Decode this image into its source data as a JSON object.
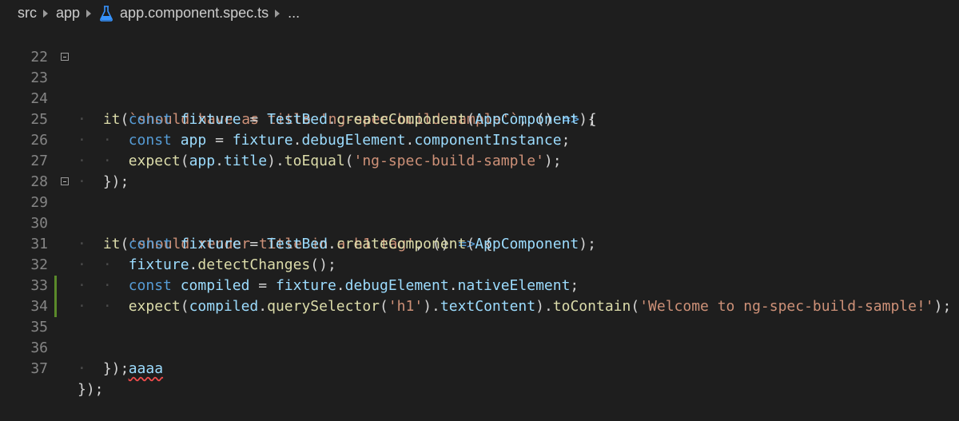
{
  "breadcrumb": {
    "items": [
      "src",
      "app",
      "app.component.spec.ts",
      "..."
    ],
    "file_icon": "flask-icon"
  },
  "editor": {
    "lines": [
      {
        "n": "22"
      },
      {
        "n": "23",
        "fold": true,
        "t": {
          "a": "it",
          "b": "(",
          "c": "`should have as title 'ng-spec-build-sample'`",
          "d": ", () ",
          "e": "=>",
          "f": " {"
        }
      },
      {
        "n": "24",
        "t": {
          "a": "const",
          "b": "fixture",
          "c": " = ",
          "d": "TestBed",
          "e": ".",
          "f": "createComponent",
          "g": "(",
          "h": "AppComponent",
          "i": ");"
        }
      },
      {
        "n": "25",
        "t": {
          "a": "const",
          "b": "app",
          "c": " = ",
          "d": "fixture",
          "e": ".",
          "f": "debugElement",
          "g": ".",
          "h": "componentInstance",
          "i": ";"
        }
      },
      {
        "n": "26",
        "t": {
          "a": "expect",
          "b": "(",
          "c": "app",
          "d": ".",
          "e": "title",
          "f": ").",
          "g": "toEqual",
          "h": "(",
          "i": "'ng-spec-build-sample'",
          "j": ");"
        }
      },
      {
        "n": "27",
        "t": {
          "a": "});"
        }
      },
      {
        "n": "28"
      },
      {
        "n": "29",
        "fold": true,
        "t": {
          "a": "it",
          "b": "(",
          "c": "'should render title in a h1 tag'",
          "d": ", () ",
          "e": "=>",
          "f": " {"
        }
      },
      {
        "n": "30",
        "t": {
          "a": "const",
          "b": "fixture",
          "c": " = ",
          "d": "TestBed",
          "e": ".",
          "f": "createComponent",
          "g": "(",
          "h": "AppComponent",
          "i": ");"
        }
      },
      {
        "n": "31",
        "t": {
          "a": "fixture",
          "b": ".",
          "c": "detectChanges",
          "d": "();"
        }
      },
      {
        "n": "32",
        "t": {
          "a": "const",
          "b": "compiled",
          "c": " = ",
          "d": "fixture",
          "e": ".",
          "f": "debugElement",
          "g": ".",
          "h": "nativeElement",
          "i": ";"
        }
      },
      {
        "n": "33",
        "t": {
          "a": "expect",
          "b": "(",
          "c": "compiled",
          "d": ".",
          "e": "querySelector",
          "f": "(",
          "g": "'h1'",
          "h": ").",
          "i": "textContent",
          "j": ").",
          "k": "toContain",
          "l": "(",
          "m": "'Welcome to ng-spec-build-sample!'",
          "n": ");"
        }
      },
      {
        "n": "34",
        "modified": true
      },
      {
        "n": "35",
        "modified": true,
        "t": {
          "a": "aaaa"
        }
      },
      {
        "n": "36",
        "t": {
          "a": "});"
        }
      },
      {
        "n": "37",
        "t": {
          "a": "});"
        }
      }
    ]
  },
  "colors": {
    "background": "#1e1e1e",
    "keyword": "#569cd6",
    "string": "#ce9178",
    "function": "#dcdcaa",
    "variable": "#9cdcfe",
    "class": "#4ec9b0",
    "modified_gutter": "#5a8a2a",
    "error_squiggle": "#f14c4c"
  }
}
